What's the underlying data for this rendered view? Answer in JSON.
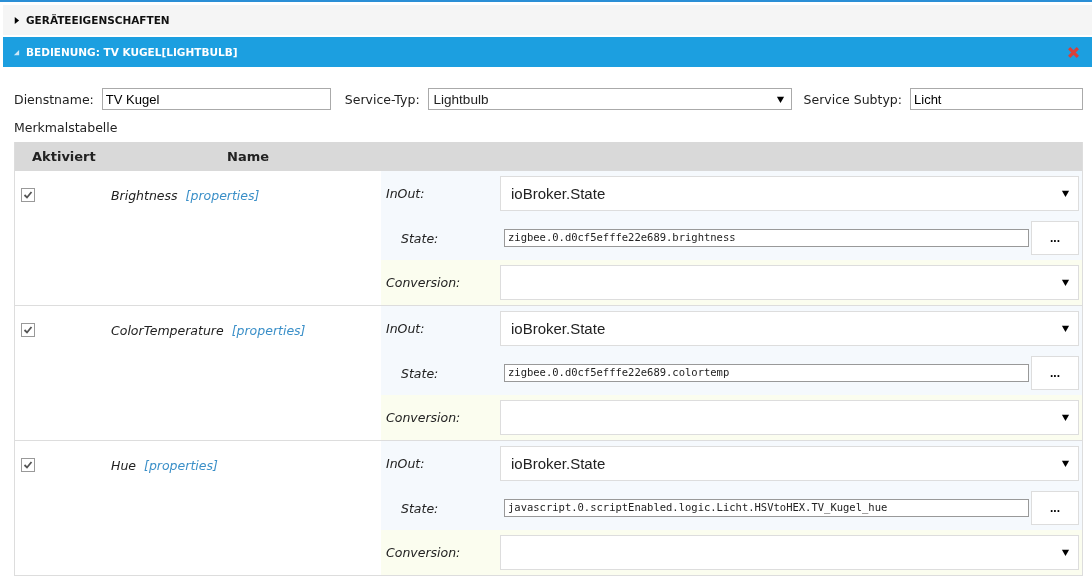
{
  "sections": [
    {
      "title": "GERÄTEEIGENSCHAFTEN",
      "expanded": false
    },
    {
      "title": "BEDIENUNG: TV KUGEL[LIGHTBULB]",
      "expanded": true
    }
  ],
  "form": {
    "service_name_label": "Dienstname:",
    "service_name": "TV Kugel",
    "service_type_label": "Service-Typ:",
    "service_type": "Lightbulb",
    "service_subtype_label": "Service Subtyp:",
    "service_subtype": "Licht"
  },
  "table_title": "Merkmalstabelle",
  "table": {
    "columns": [
      "Aktiviert",
      "Name"
    ],
    "rows": [
      {
        "checked": true,
        "name": "Brightness",
        "link": "[properties]",
        "inout_label": "InOut:",
        "inout": "ioBroker.State",
        "state_label": "State:",
        "state": "zigbee.0.d0cf5efffe22e689.brightness",
        "browse": "...",
        "conversion_label": "Conversion:"
      },
      {
        "checked": true,
        "name": "ColorTemperature",
        "link": "[properties]",
        "inout_label": "InOut:",
        "inout": "ioBroker.State",
        "state_label": "State:",
        "state": "zigbee.0.d0cf5efffe22e689.colortemp",
        "browse": "...",
        "conversion_label": "Conversion:"
      },
      {
        "checked": true,
        "name": "Hue",
        "link": "[properties]",
        "inout_label": "InOut:",
        "inout": "ioBroker.State",
        "state_label": "State:",
        "state": "javascript.0.scriptEnabled.logic.Licht.HSVtoHEX.TV_Kugel_hue",
        "browse": "...",
        "conversion_label": "Conversion:"
      }
    ]
  }
}
